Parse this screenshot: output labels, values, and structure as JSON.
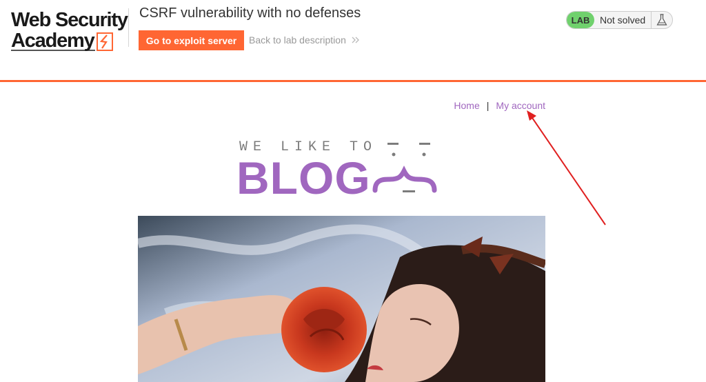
{
  "lab_header": {
    "logo_line1": "Web Security",
    "logo_line2": "Academy",
    "title": "CSRF vulnerability with no defenses",
    "exploit_button": "Go to exploit server",
    "back_link": "Back to lab description",
    "status_pill": "LAB",
    "status_text": "Not solved",
    "accent_color": "#ff6633",
    "status_color": "#70d16d"
  },
  "blog_nav": {
    "home": "Home",
    "separator": "|",
    "my_account": "My account",
    "link_color": "#a067bf"
  },
  "blog_header": {
    "tagline": "WE LIKE TO",
    "word": "BLOG"
  },
  "icons": {
    "back_chevron": "double-chevron-right-icon",
    "flask": "flask-icon",
    "logo_mark": "lightning-bracket-icon"
  }
}
